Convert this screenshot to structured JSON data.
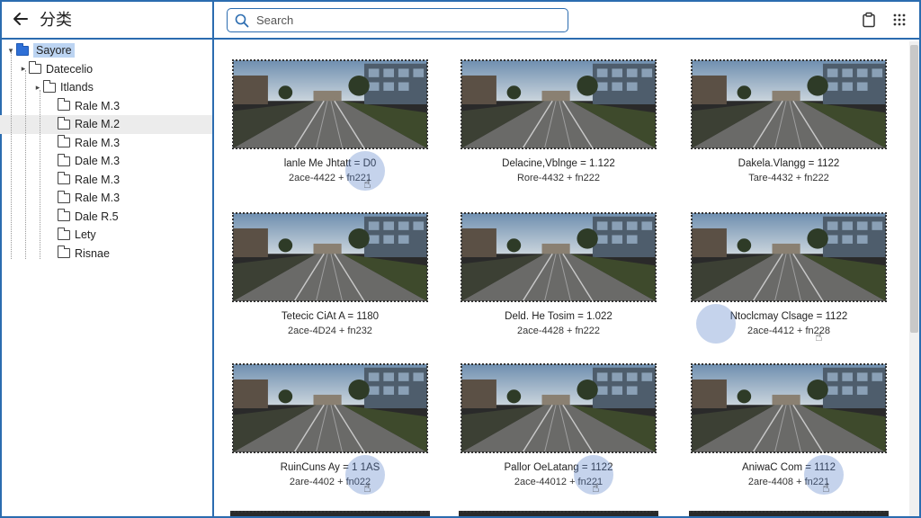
{
  "header": {
    "title": "分类",
    "back_icon": "arrow-left-icon"
  },
  "search": {
    "placeholder": "Search",
    "value": ""
  },
  "toolbar": {
    "clipboard_icon": "clipboard-icon",
    "grid_icon": "grid-dots-icon"
  },
  "tree": {
    "items": [
      {
        "label": "Sayore",
        "level": 0,
        "twisty": "▾",
        "root": true,
        "selected": true
      },
      {
        "label": "Datecelio",
        "level": 1,
        "twisty": "▸"
      },
      {
        "label": "Itlands",
        "level": 2,
        "twisty": "▸"
      },
      {
        "label": "Rale M.3",
        "level": 3,
        "twisty": ""
      },
      {
        "label": "Rale M.2",
        "level": 3,
        "twisty": "",
        "hover": true
      },
      {
        "label": "Rale M.3",
        "level": 3,
        "twisty": ""
      },
      {
        "label": "Dale M.3",
        "level": 3,
        "twisty": ""
      },
      {
        "label": "Rale M.3",
        "level": 3,
        "twisty": ""
      },
      {
        "label": "Rale M.3",
        "level": 3,
        "twisty": ""
      },
      {
        "label": "Dale R.5",
        "level": 3,
        "twisty": ""
      },
      {
        "label": "Lety",
        "level": 3,
        "twisty": ""
      },
      {
        "label": "Risnae",
        "level": 3,
        "twisty": ""
      }
    ]
  },
  "cards": [
    {
      "line1": "lanle Me Jhtatt = D0",
      "line2": "2ace-4422 + fn221",
      "cursor": true
    },
    {
      "line1": "Delacine,Vblnge = 1.122",
      "line2": "Rore-4432 + fn222",
      "cursor": false
    },
    {
      "line1": "Dakela.Vlangg = 1122",
      "line2": "Tare-4432 + fn222",
      "cursor": false
    },
    {
      "line1": "Tetecic CiAt A = 1180",
      "line2": "2ace-4D24 + fn232",
      "cursor": false
    },
    {
      "line1": "Deld. He Tosim = 1.022",
      "line2": "2ace-4428 + fn222",
      "cursor": false
    },
    {
      "line1": "Ntoclcmay Clsage = 1122",
      "line2": "2ace-4412 + fn228",
      "cursor": true
    },
    {
      "line1": "RuinCuns Ay = 1 1AS",
      "line2": "2are-4402 + fn022",
      "cursor": true
    },
    {
      "line1": "Pallor OeLatang = 1122",
      "line2": "2ace-44012 + fn221",
      "cursor": true
    },
    {
      "line1": "AniwaC Com = 1112",
      "line2": "2are-4408 + fn221",
      "cursor": true
    }
  ]
}
